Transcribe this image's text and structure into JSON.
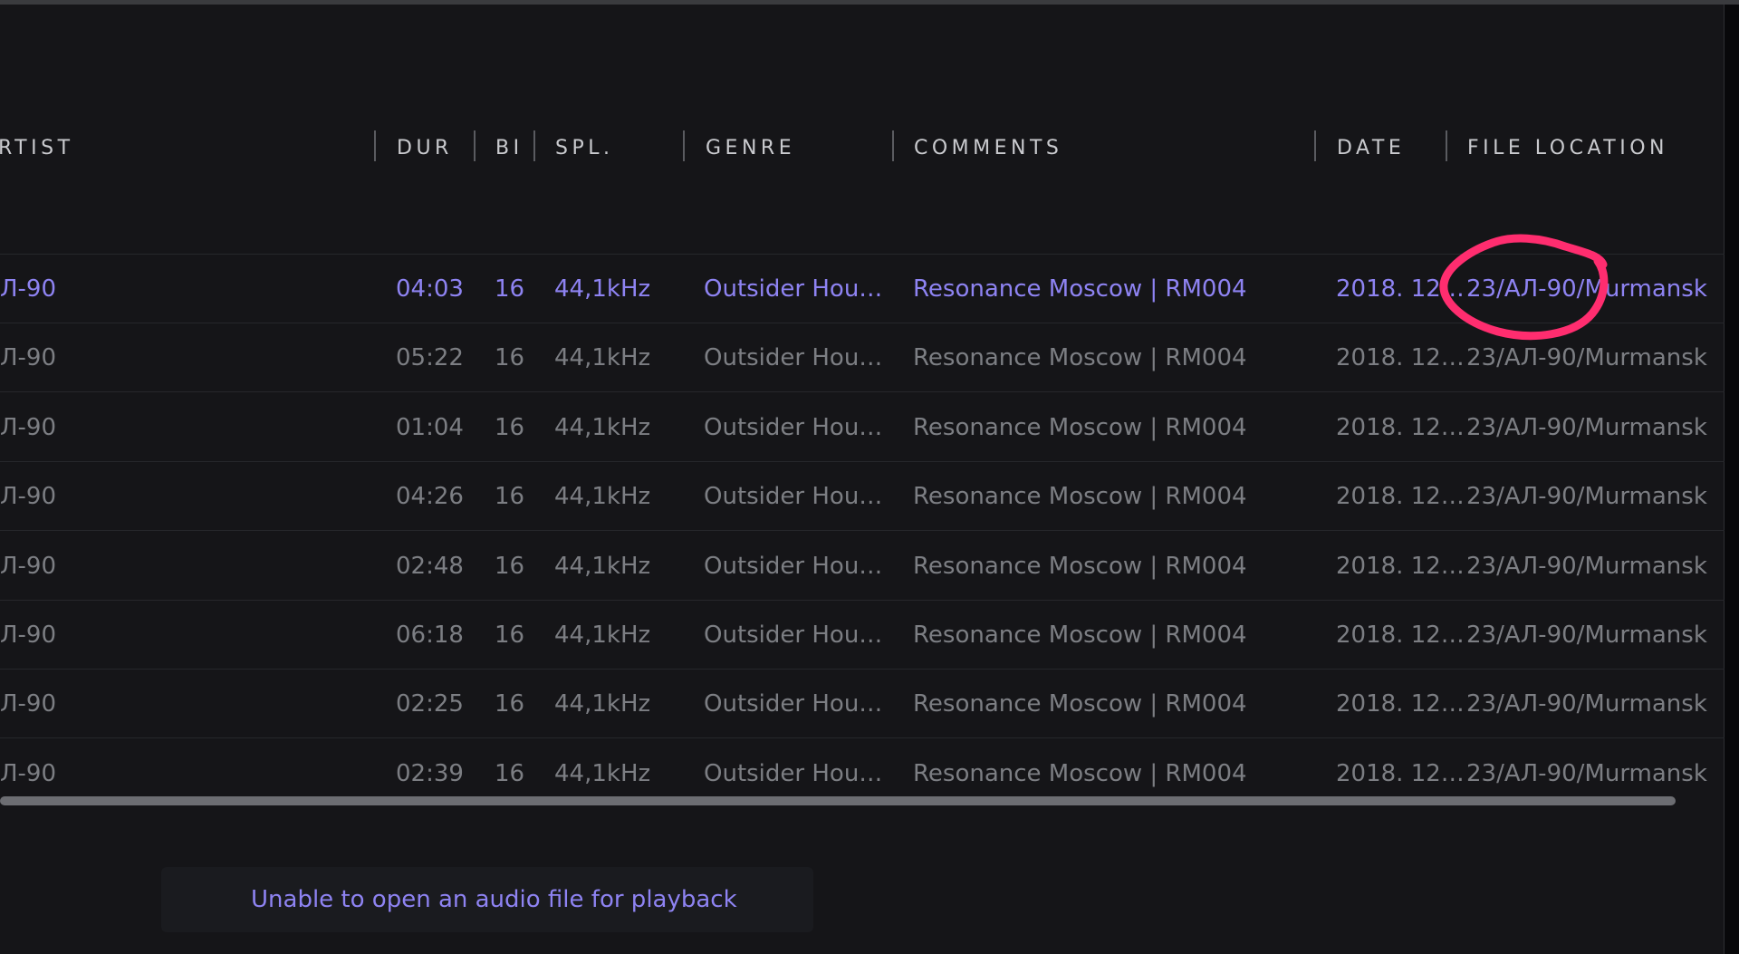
{
  "table": {
    "columns": [
      {
        "key": "artist",
        "label": "RTIST"
      },
      {
        "key": "dur",
        "label": "DUR"
      },
      {
        "key": "bits",
        "label": "BI"
      },
      {
        "key": "spl",
        "label": "SPL."
      },
      {
        "key": "genre",
        "label": "GENRE"
      },
      {
        "key": "comments",
        "label": "COMMENTS"
      },
      {
        "key": "date",
        "label": "DATE"
      },
      {
        "key": "location",
        "label": "FILE LOCATION"
      }
    ],
    "rows": [
      {
        "artist": "Л-90",
        "dur": "04:03",
        "bits": "16",
        "spl": "44,1kHz",
        "genre": "Outsider Hou…",
        "comments": "Resonance Moscow | RM004",
        "date": "2018. 12…",
        "location": "23/АЛ-90/Murmansk",
        "selected": true
      },
      {
        "artist": "Л-90",
        "dur": "05:22",
        "bits": "16",
        "spl": "44,1kHz",
        "genre": "Outsider Hou…",
        "comments": "Resonance Moscow | RM004",
        "date": "2018. 12…",
        "location": "23/АЛ-90/Murmansk",
        "selected": false
      },
      {
        "artist": "Л-90",
        "dur": "01:04",
        "bits": "16",
        "spl": "44,1kHz",
        "genre": "Outsider Hou…",
        "comments": "Resonance Moscow | RM004",
        "date": "2018. 12…",
        "location": "23/АЛ-90/Murmansk",
        "selected": false
      },
      {
        "artist": "Л-90",
        "dur": "04:26",
        "bits": "16",
        "spl": "44,1kHz",
        "genre": "Outsider Hou…",
        "comments": "Resonance Moscow | RM004",
        "date": "2018. 12…",
        "location": "23/АЛ-90/Murmansk",
        "selected": false
      },
      {
        "artist": "Л-90",
        "dur": "02:48",
        "bits": "16",
        "spl": "44,1kHz",
        "genre": "Outsider Hou…",
        "comments": "Resonance Moscow | RM004",
        "date": "2018. 12…",
        "location": "23/АЛ-90/Murmansk",
        "selected": false
      },
      {
        "artist": "Л-90",
        "dur": "06:18",
        "bits": "16",
        "spl": "44,1kHz",
        "genre": "Outsider Hou…",
        "comments": "Resonance Moscow | RM004",
        "date": "2018. 12…",
        "location": "23/АЛ-90/Murmansk",
        "selected": false
      },
      {
        "artist": "Л-90",
        "dur": "02:25",
        "bits": "16",
        "spl": "44,1kHz",
        "genre": "Outsider Hou…",
        "comments": "Resonance Moscow | RM004",
        "date": "2018. 12…",
        "location": "23/АЛ-90/Murmansk",
        "selected": false
      },
      {
        "artist": "Л-90",
        "dur": "02:39",
        "bits": "16",
        "spl": "44,1kHz",
        "genre": "Outsider Hou…",
        "comments": "Resonance Moscow | RM004",
        "date": "2018. 12…",
        "location": "23/АЛ-90/Murmansk",
        "selected": false
      }
    ]
  },
  "status": {
    "message": "Unable to open an audio file for playback"
  },
  "colors": {
    "accent": "#8e83f2",
    "row_text": "#7c7e83",
    "header_text": "#c9cace",
    "background": "#151518",
    "annotation": "#ff2d6f"
  }
}
